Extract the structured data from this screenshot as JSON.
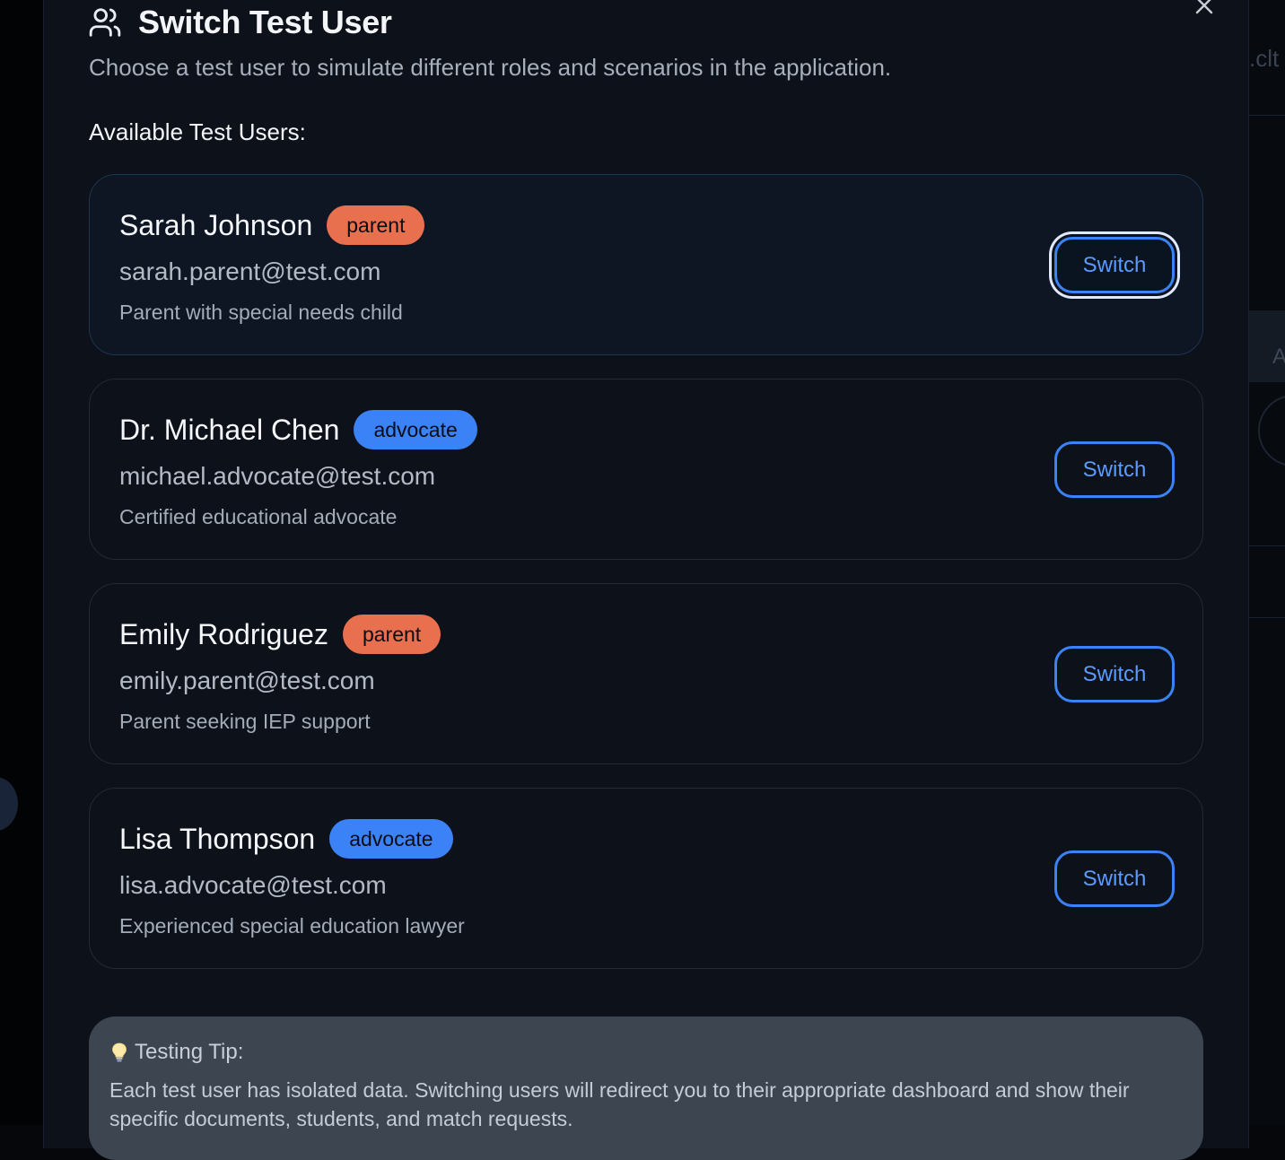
{
  "background": {
    "fragment_text": ".clt",
    "fragment_letter": "A"
  },
  "dialog": {
    "title": "Switch Test User",
    "title_icon": "users-icon",
    "close_icon": "close-icon",
    "subtitle": "Choose a test user to simulate different roles and scenarios in the application.",
    "section_label": "Available Test Users:",
    "users": [
      {
        "name": "Sarah Johnson",
        "role": "parent",
        "email": "sarah.parent@test.com",
        "description": "Parent with special needs child",
        "button": "Switch",
        "focused": true
      },
      {
        "name": "Dr. Michael Chen",
        "role": "advocate",
        "email": "michael.advocate@test.com",
        "description": "Certified educational advocate",
        "button": "Switch",
        "focused": false
      },
      {
        "name": "Emily Rodriguez",
        "role": "parent",
        "email": "emily.parent@test.com",
        "description": "Parent seeking IEP support",
        "button": "Switch",
        "focused": false
      },
      {
        "name": "Lisa Thompson",
        "role": "advocate",
        "email": "lisa.advocate@test.com",
        "description": "Experienced special education lawyer",
        "button": "Switch",
        "focused": false
      }
    ],
    "tip": {
      "icon": "lightbulb-icon",
      "title": "Testing Tip:",
      "body": "Each test user has isolated data. Switching users will redirect you to their appropriate dashboard and show their specific documents, students, and match requests."
    }
  },
  "colors": {
    "parent_badge": "#e8704f",
    "advocate_badge": "#3b82f6",
    "accent": "#3b82f6",
    "dialog_bg": "#0c111a"
  }
}
